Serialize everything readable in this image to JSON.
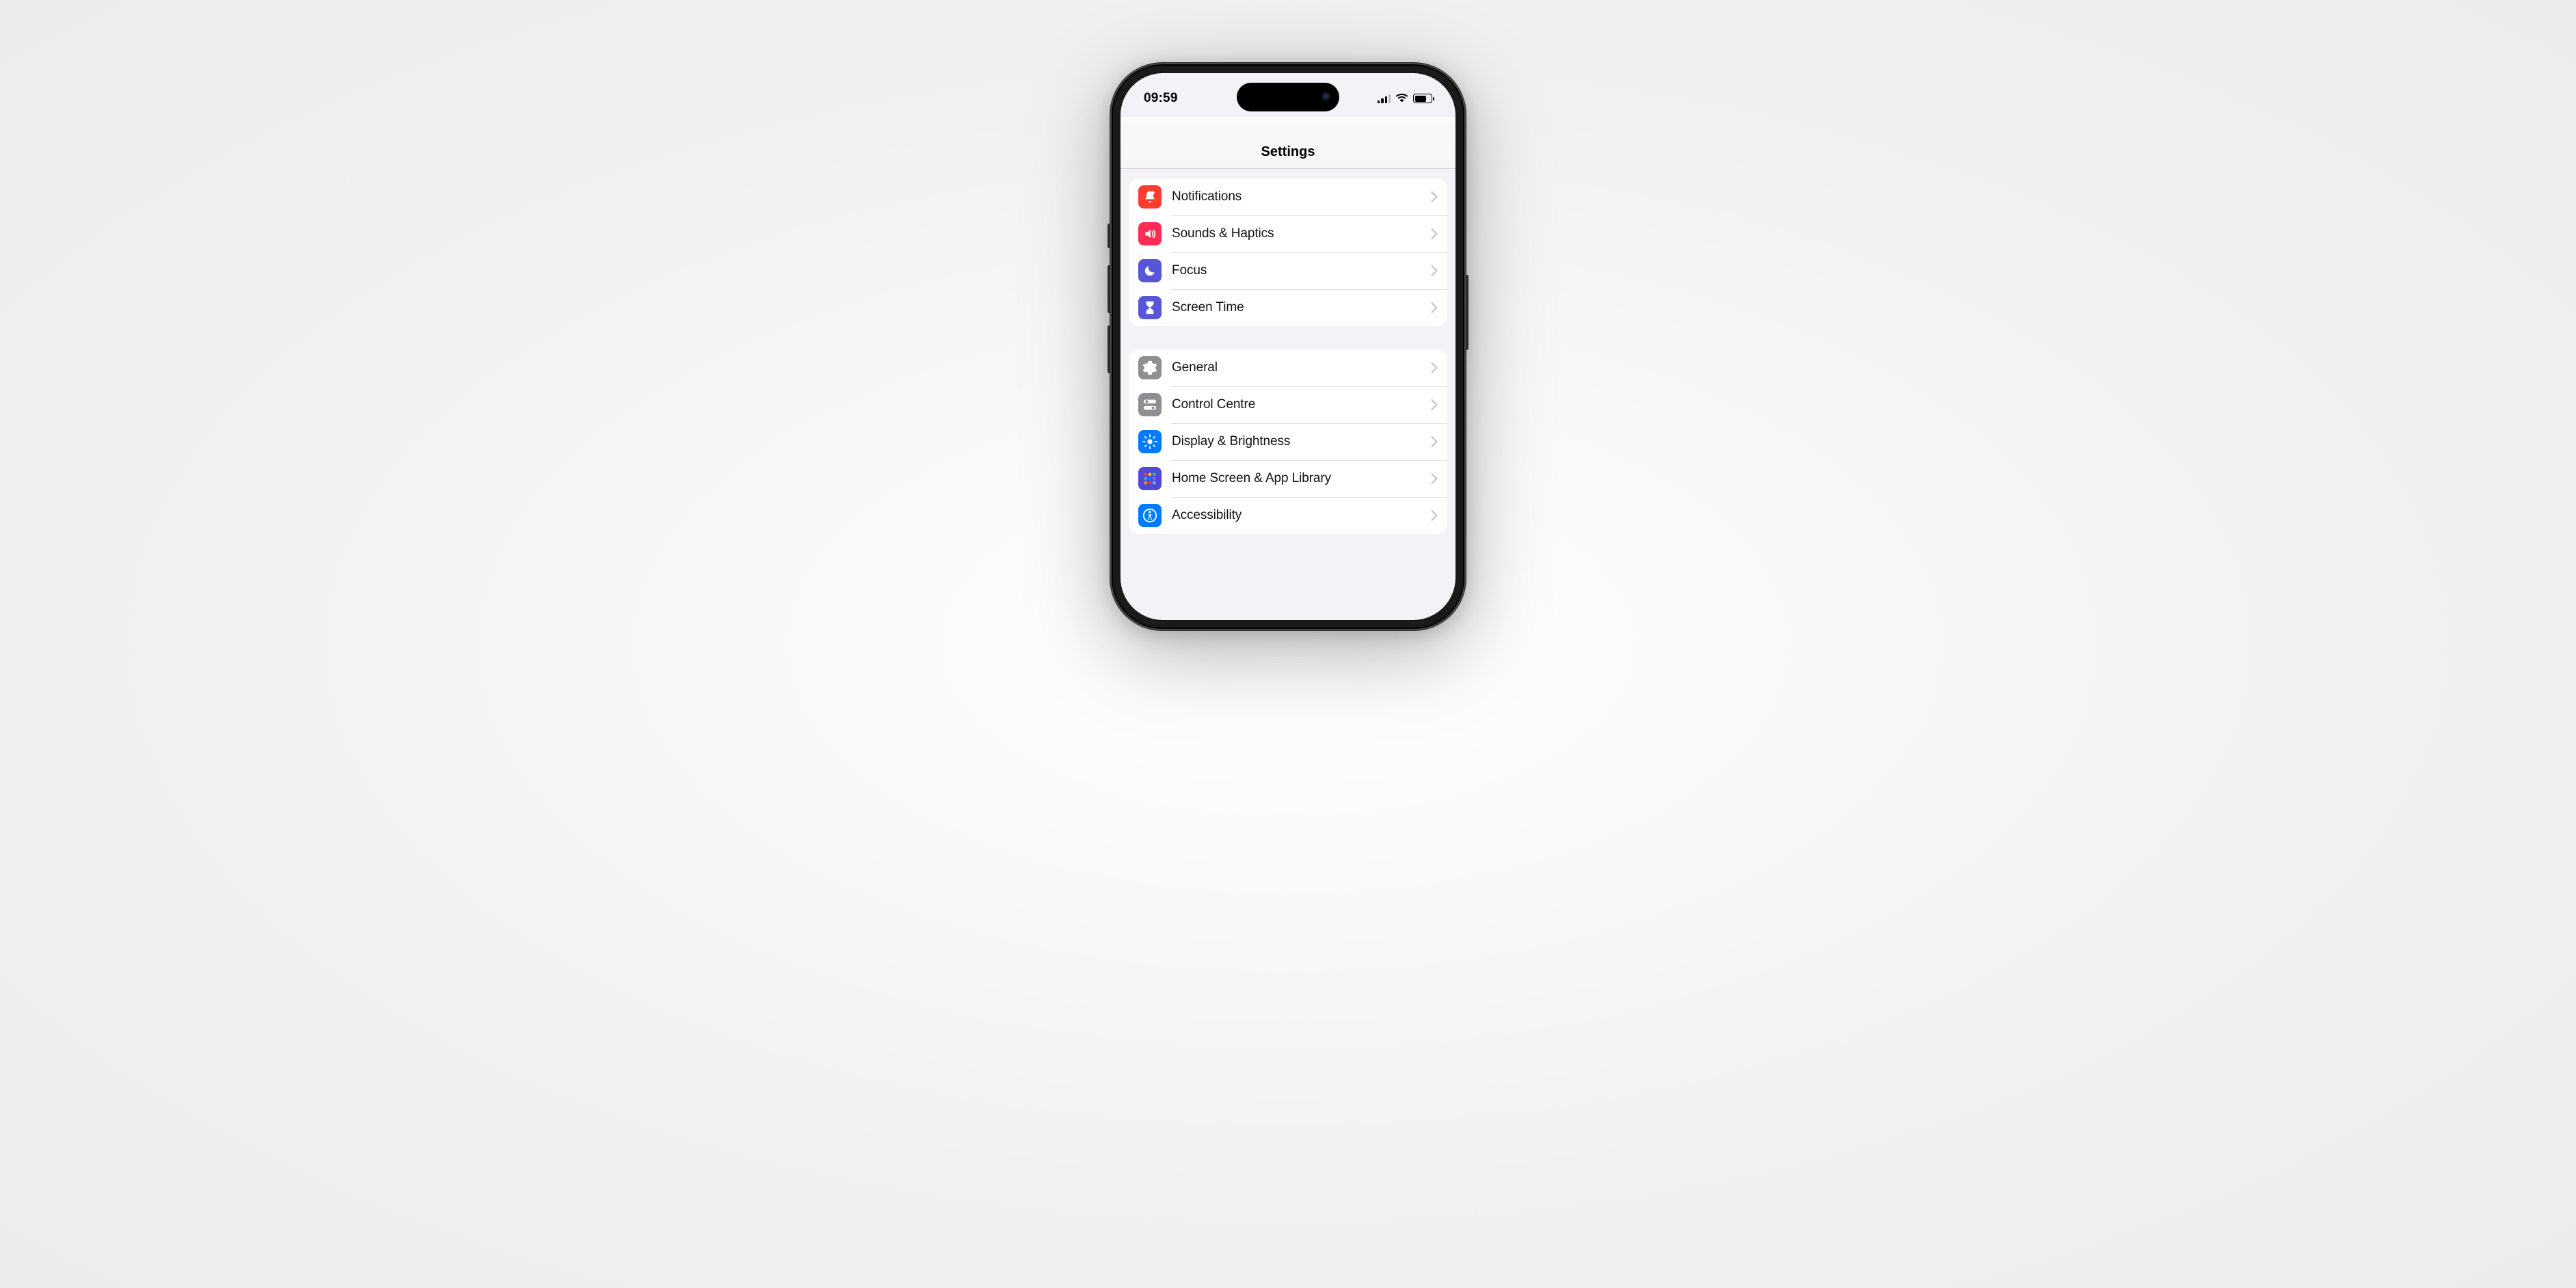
{
  "status": {
    "time": "09:59"
  },
  "navbar": {
    "title": "Settings"
  },
  "groups": [
    {
      "rows": [
        {
          "label": "Notifications"
        },
        {
          "label": "Sounds & Haptics"
        },
        {
          "label": "Focus"
        },
        {
          "label": "Screen Time"
        }
      ]
    },
    {
      "rows": [
        {
          "label": "General"
        },
        {
          "label": "Control Centre"
        },
        {
          "label": "Display & Brightness"
        },
        {
          "label": "Home Screen & App Library"
        },
        {
          "label": "Accessibility"
        }
      ]
    }
  ]
}
